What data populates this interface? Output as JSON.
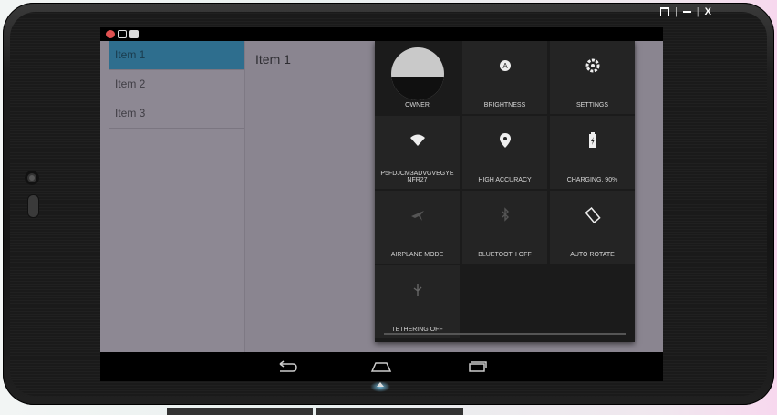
{
  "window": {
    "controls": [
      "restore-icon",
      "minimize-icon",
      "close-icon"
    ],
    "close_glyph": "X"
  },
  "statusbar": {
    "icons": [
      "app-icon-red",
      "gallery-icon",
      "game-controller-icon"
    ]
  },
  "list": {
    "items": [
      {
        "label": "Item 1",
        "selected": true
      },
      {
        "label": "Item 2",
        "selected": false
      },
      {
        "label": "Item 3",
        "selected": false
      }
    ]
  },
  "detail": {
    "title": "Item 1"
  },
  "quick_settings": {
    "owner": "OWNER",
    "brightness": "BRIGHTNESS",
    "settings": "SETTINGS",
    "wifi": "P5FDJCM3ADVGVEGYE NFR27",
    "location": "HIGH ACCURACY",
    "battery": "CHARGING, 90%",
    "airplane": "AIRPLANE MODE",
    "bluetooth": "BLUETOOTH OFF",
    "rotate": "AUTO ROTATE",
    "tethering": "TETHERING OFF"
  },
  "navbar": {
    "icons": [
      "back-icon",
      "home-icon",
      "recents-icon"
    ]
  },
  "colors": {
    "accent": "#2e6e8e",
    "panel": "#1b1b1b",
    "tile": "#242424"
  }
}
